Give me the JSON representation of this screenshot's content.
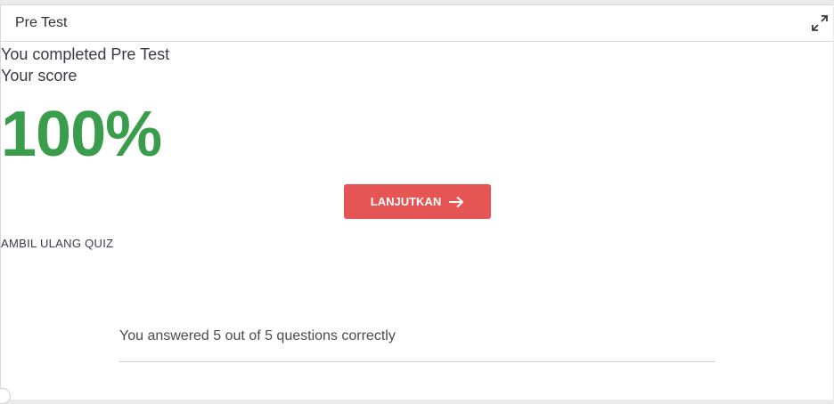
{
  "header": {
    "title": "Pre Test",
    "expand_icon": "expand-arrows-icon"
  },
  "result": {
    "completed_text": "You completed Pre Test",
    "score_label": "Your score",
    "score_value": "100%",
    "score_color": "#3a9d4b",
    "continue_label": "LANJUTKAN",
    "continue_color": "#e55553",
    "retake_label": "AMBIL ULANG QUIZ",
    "answered_text": "You answered 5 out of 5 questions correctly"
  }
}
